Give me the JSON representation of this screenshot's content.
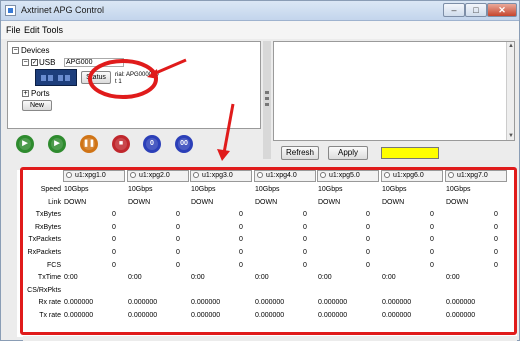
{
  "window": {
    "title": "Axtrinet APG Control"
  },
  "menu": [
    "File",
    "Edit",
    "Tools"
  ],
  "tree": {
    "root_label": "Devices",
    "usb_label": "USB",
    "device_field_value": "APG000",
    "status_label": "Status",
    "serial_line": "rial: APG000010",
    "serial_line2": "t 1",
    "ports_label": "Ports",
    "new_label": "New"
  },
  "controls": [
    {
      "name": "play-button",
      "glyph": "▶",
      "color": "#2e8b2e"
    },
    {
      "name": "step-button",
      "glyph": "▶",
      "color": "#2e8b2e"
    },
    {
      "name": "pause-button",
      "glyph": "❚❚",
      "color": "#d07416"
    },
    {
      "name": "stop-button",
      "glyph": "■",
      "color": "#c0272d"
    },
    {
      "name": "zero-button",
      "glyph": "0",
      "color": "#2b3fb8"
    },
    {
      "name": "double-zero-button",
      "glyph": "00",
      "color": "#2b3fb8"
    }
  ],
  "actions": {
    "refresh_label": "Refresh",
    "apply_label": "Apply",
    "highlight_color": "#ffff00"
  },
  "table": {
    "columns": [
      "u1:xpg1.0",
      "u1:xpg2.0",
      "u1:xpg3.0",
      "u1:xpg4.0",
      "u1:xpg5.0",
      "u1:xpg6.0",
      "u1:xpg7.0"
    ],
    "row_labels": [
      "Speed",
      "Link",
      "TxBytes",
      "RxBytes",
      "TxPackets",
      "RxPackets",
      "FCS",
      "TxTime",
      "CS/RxPkts",
      "Rx rate",
      "Tx rate"
    ],
    "rows": {
      "Speed": [
        "10Gbps",
        "10Gbps",
        "10Gbps",
        "10Gbps",
        "10Gbps",
        "10Gbps",
        "10Gbps"
      ],
      "Link": [
        "DOWN",
        "DOWN",
        "DOWN",
        "DOWN",
        "DOWN",
        "DOWN",
        "DOWN"
      ],
      "TxBytes": [
        "0",
        "0",
        "0",
        "0",
        "0",
        "0",
        "0"
      ],
      "RxBytes": [
        "0",
        "0",
        "0",
        "0",
        "0",
        "0",
        "0"
      ],
      "TxPackets": [
        "0",
        "0",
        "0",
        "0",
        "0",
        "0",
        "0"
      ],
      "RxPackets": [
        "0",
        "0",
        "0",
        "0",
        "0",
        "0",
        "0"
      ],
      "FCS": [
        "0",
        "0",
        "0",
        "0",
        "0",
        "0",
        "0"
      ],
      "TxTime": [
        "0:00",
        "0:00",
        "0:00",
        "0:00",
        "0:00",
        "0:00",
        "0:00"
      ],
      "CS/RxPkts": [
        "",
        "",
        "",
        "",
        "",
        "",
        ""
      ],
      "Rx rate": [
        "0.000000",
        "0.000000",
        "0.000000",
        "0.000000",
        "0.000000",
        "0.000000",
        "0.000000"
      ],
      "Tx rate": [
        "0.000000",
        "0.000000",
        "0.000000",
        "0.000000",
        "0.000000",
        "0.000000",
        "0.000000"
      ]
    }
  },
  "annotation_color": "#e01b1b"
}
